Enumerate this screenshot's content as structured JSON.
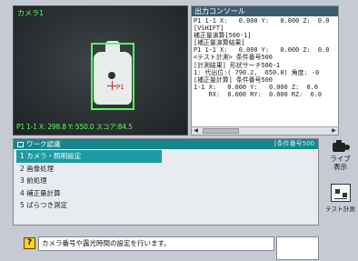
{
  "camera": {
    "label": "カメラ1",
    "status": "P1 1-1 X: 298.8 Y: 550.0 スコア:84.5",
    "marker_label": "P1"
  },
  "console": {
    "title": "出力コンソール",
    "lines": [
      "P1 1-1 X:   0.000 Y:   0.000 Z:  0.0",
      "[VSHIFT]",
      "補正量演算[500-1]",
      "[補正量演算結果]",
      "P1 1-1 X:   0.000 Y:   0.000 Z:  0.0",
      "<テスト計測> 条件番号500",
      "[計測結果] 形状サーチ500-1",
      "1: 代出位:( 790.2,  650.0) 角度: -0",
      "[補正量計算] 条件番号500",
      "1-1 X:   0.000 Y:   0.000 Z:  0.0",
      "    RX:  0.000 RY:  0.000 RZ:  0.0"
    ]
  },
  "flow": {
    "title": "ワーク認識",
    "condition": "[条件番号500",
    "items": [
      "1 カメラ・照明設定",
      "2 画像処理",
      "3 前処理",
      "4 補正量計算",
      "5 ばらつき測定"
    ]
  },
  "side": {
    "live_label": "ライブ\n表示",
    "test_label": "テスト計測"
  },
  "message": {
    "text": "カメラ番号や露光時間の設定を行います。",
    "help_icon": "?"
  }
}
